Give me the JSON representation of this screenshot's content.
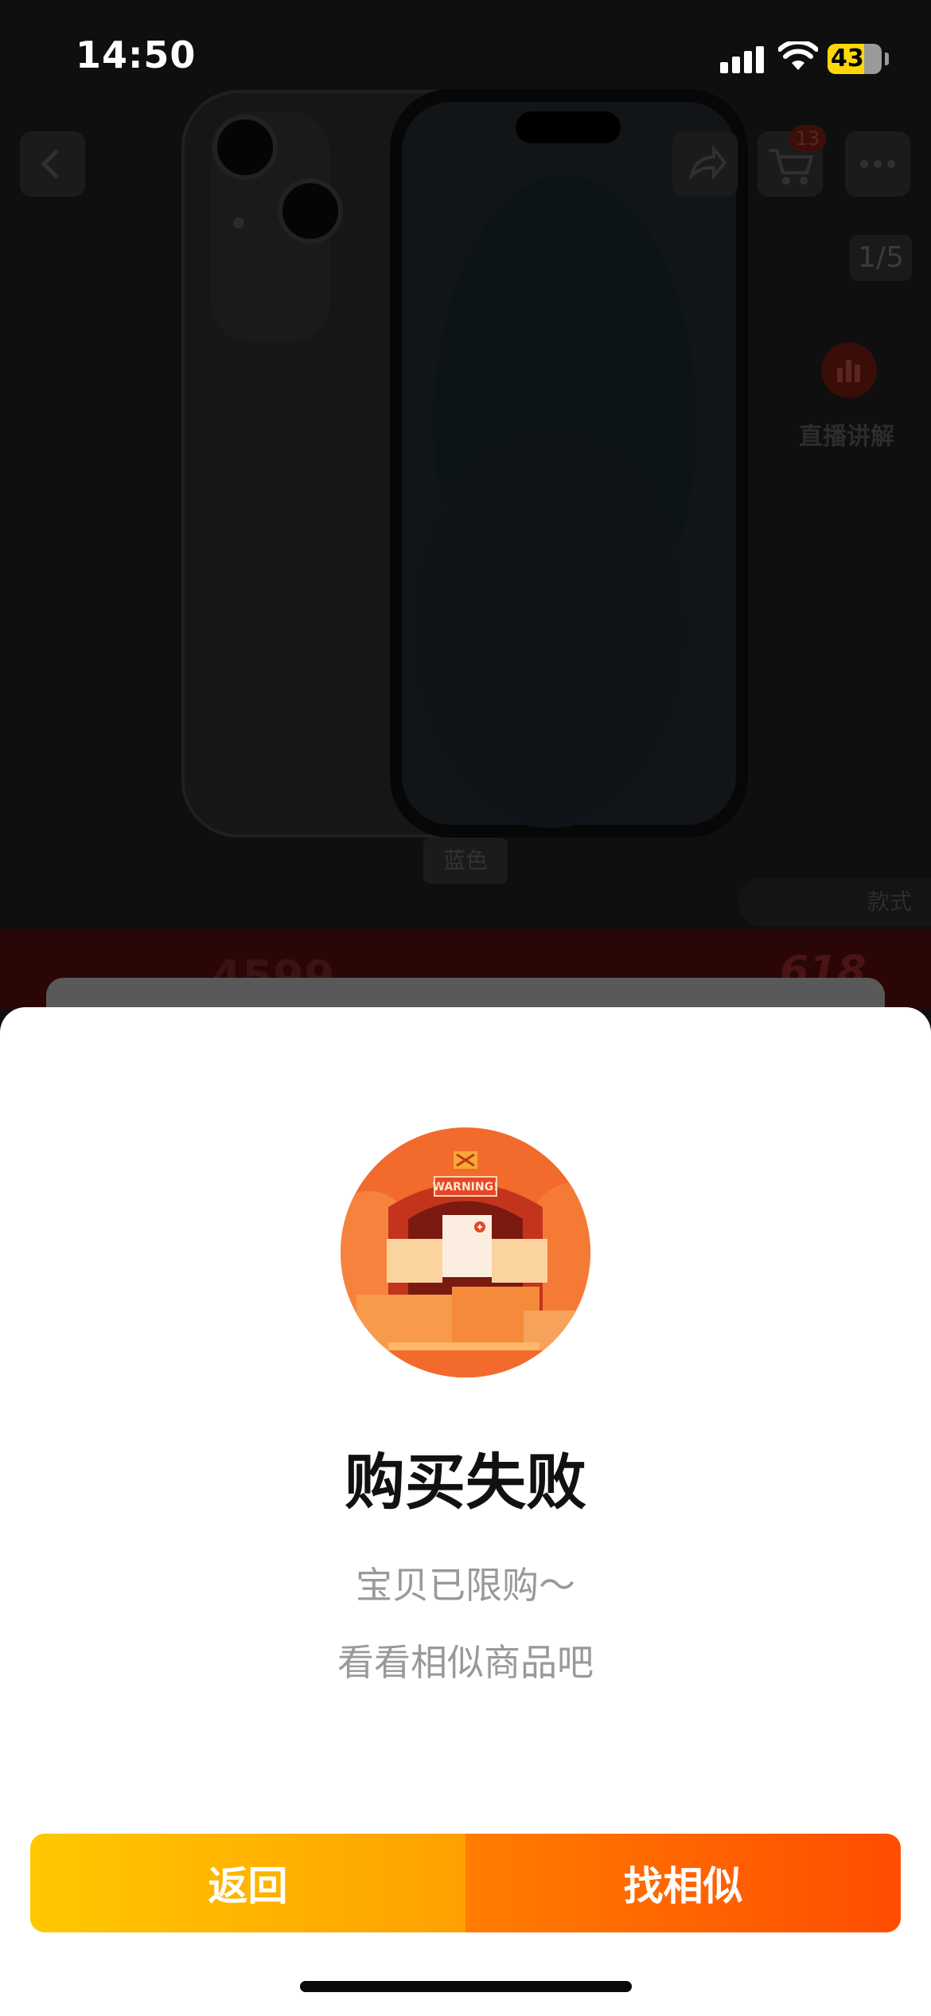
{
  "status_bar": {
    "time": "14:50",
    "battery": "43"
  },
  "product_page": {
    "cart_count": "13",
    "image_index": "1/5",
    "live_label": "直播讲解",
    "color_tag": "蓝色",
    "style_tag": "款式",
    "price": "4599",
    "promo": "618",
    "icons": [
      "back-icon",
      "share-icon",
      "cart-icon",
      "more-icon",
      "live-chart-icon"
    ]
  },
  "dialog": {
    "illustration_text": "WARNING!",
    "title": "购买失败",
    "message_line1": "宝贝已限购～",
    "message_line2": "看看相似商品吧",
    "back_button": "返回",
    "similar_button": "找相似"
  },
  "colors": {
    "overlay": "#0f0f0f",
    "back_button_start": "#ffc800",
    "back_button_end": "#ffa000",
    "similar_button_start": "#ff7d00",
    "similar_button_end": "#ff4d00",
    "message_gray": "#999999"
  }
}
